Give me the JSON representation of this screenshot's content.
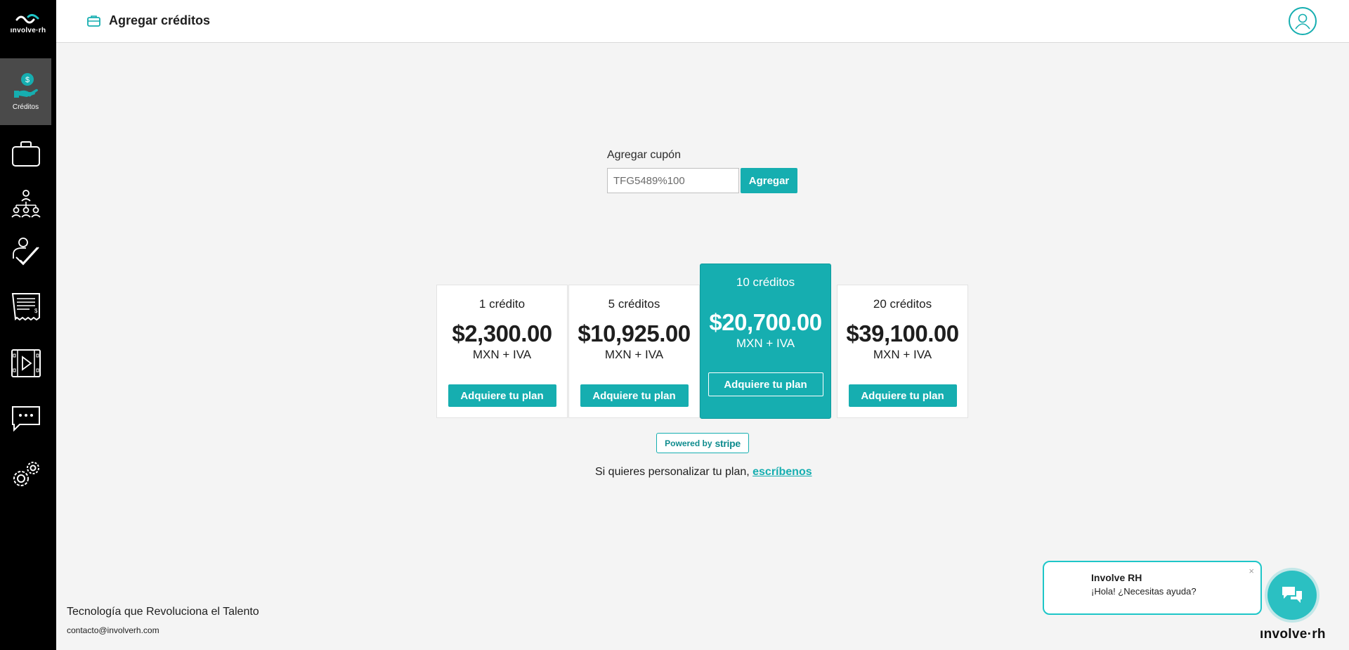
{
  "app": {
    "logo_text": "ınvolve·rh"
  },
  "sidebar": {
    "active_label": "Créditos",
    "items": [
      {
        "name": "briefcase-icon"
      },
      {
        "name": "org-chart-icon"
      },
      {
        "name": "approval-check-icon"
      },
      {
        "name": "receipt-icon"
      },
      {
        "name": "video-icon"
      },
      {
        "name": "chat-icon"
      },
      {
        "name": "settings-gears-icon"
      }
    ]
  },
  "header": {
    "title": "Agregar créditos"
  },
  "coupon": {
    "label": "Agregar cupón",
    "value": "TFG5489%100",
    "button": "Agregar"
  },
  "plans": [
    {
      "title": "1 crédito",
      "price": "$2,300.00",
      "sub": "MXN + IVA",
      "button": "Adquiere tu plan"
    },
    {
      "title": "5 créditos",
      "price": "$10,925.00",
      "sub": "MXN + IVA",
      "button": "Adquiere tu plan"
    },
    {
      "title": "10 créditos",
      "price": "$20,700.00",
      "sub": "MXN + IVA",
      "button": "Adquiere tu plan",
      "featured": true
    },
    {
      "title": "20 créditos",
      "price": "$39,100.00",
      "sub": "MXN + IVA",
      "button": "Adquiere tu plan"
    }
  ],
  "stripe": {
    "prefix": "Powered by",
    "brand": "stripe"
  },
  "custom_plan": {
    "text": "Si quieres personalizar tu plan, ",
    "link": "escríbenos"
  },
  "footer": {
    "tagline": "Tecnología que Revoluciona el Talento",
    "email": "contacto@involverh.com"
  },
  "chat": {
    "name": "Involve RH",
    "message": "¡Hola! ¿Necesitas ayuda?",
    "close": "×"
  },
  "brand_corner": "ınvolve·rh",
  "colors": {
    "accent": "#16aeb0",
    "sidebar": "#000000",
    "sidebar_active": "#4a4a4a",
    "background": "#f4f4f4"
  }
}
